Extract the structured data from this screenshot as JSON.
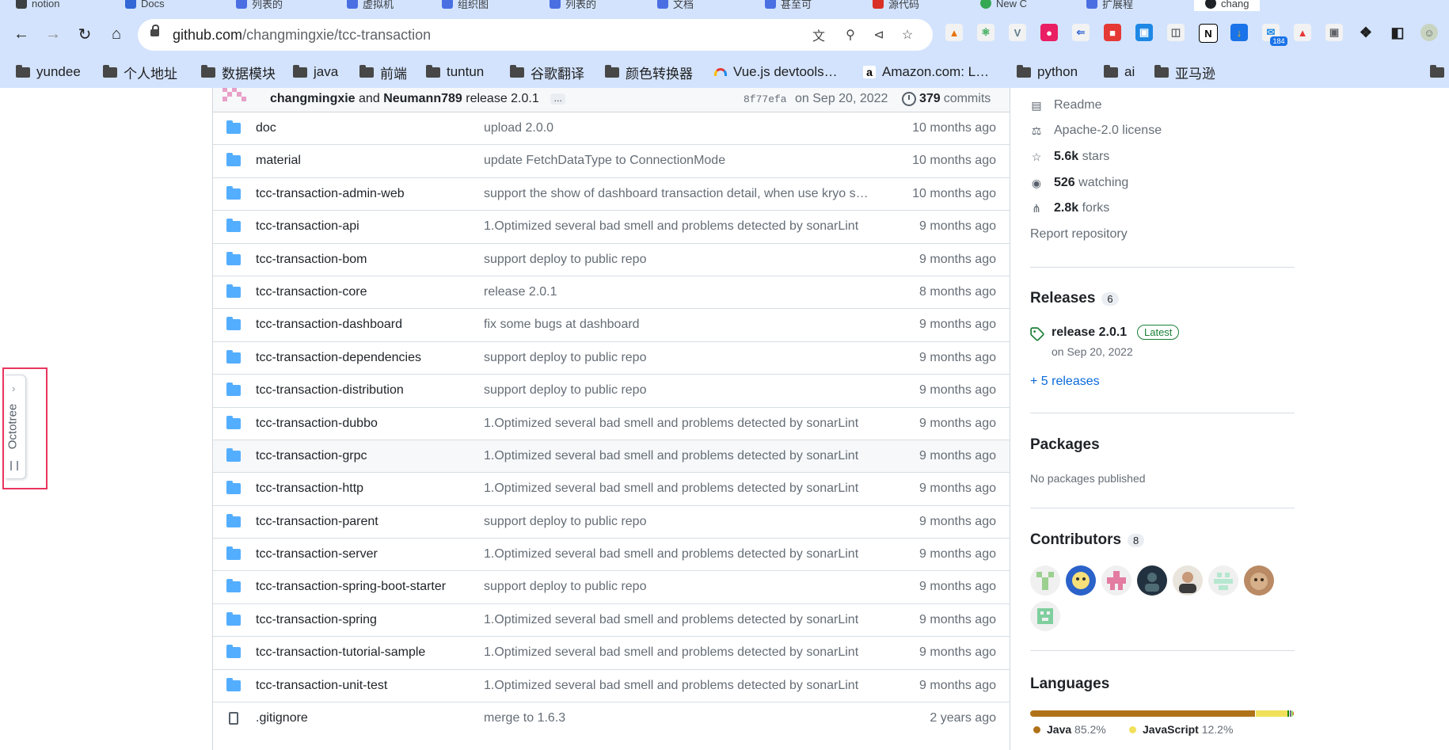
{
  "browser": {
    "tabs": [
      {
        "label": "notion"
      },
      {
        "label": "Docs"
      },
      {
        "label": "列表的"
      },
      {
        "label": "虚拟机"
      },
      {
        "label": "组织图"
      },
      {
        "label": "列表的"
      },
      {
        "label": "文档"
      },
      {
        "label": "甚至可"
      },
      {
        "label": "源代码"
      },
      {
        "label": "New C"
      },
      {
        "label": "扩展程"
      },
      {
        "label": "chang"
      }
    ],
    "url_domain": "github.com",
    "url_path": "/changmingxie/tcc-transaction",
    "extension_badge": "184",
    "bookmarks": [
      {
        "label": "yundee",
        "icon": "folder-icon"
      },
      {
        "label": "个人地址",
        "icon": "folder-icon"
      },
      {
        "label": "数据模块",
        "icon": "folder-icon"
      },
      {
        "label": "java",
        "icon": "folder-icon"
      },
      {
        "label": "前端",
        "icon": "folder-icon"
      },
      {
        "label": "tuntun",
        "icon": "folder-icon"
      },
      {
        "label": "谷歌翻译",
        "icon": "folder-icon"
      },
      {
        "label": "颜色转换器",
        "icon": "folder-icon"
      },
      {
        "label": "Vue.js devtools…",
        "icon": "rainbow-icon"
      },
      {
        "label": "Amazon.com: L…",
        "icon": "amazon-icon"
      },
      {
        "label": "python",
        "icon": "folder-icon"
      },
      {
        "label": "ai",
        "icon": "folder-icon"
      },
      {
        "label": "亚马逊",
        "icon": "folder-icon"
      }
    ]
  },
  "commit": {
    "author1": "changmingxie",
    "and": "and",
    "author2": "Neumann789",
    "message": "release 2.0.1",
    "dots": "…",
    "sha": "8f77efa",
    "date": "on Sep 20, 2022",
    "commit_count": "379",
    "commit_word": "commits"
  },
  "files": [
    {
      "name": "doc",
      "type": "dir",
      "message": "upload 2.0.0",
      "age": "10 months ago"
    },
    {
      "name": "material",
      "type": "dir",
      "message": "update FetchDataType to ConnectionMode",
      "age": "10 months ago"
    },
    {
      "name": "tcc-transaction-admin-web",
      "type": "dir",
      "message": "support the show of dashboard transaction detail, when use kryo s…",
      "age": "10 months ago"
    },
    {
      "name": "tcc-transaction-api",
      "type": "dir",
      "message": "1.Optimized several bad smell and problems detected by sonarLint",
      "age": "9 months ago"
    },
    {
      "name": "tcc-transaction-bom",
      "type": "dir",
      "message": "support deploy to public repo",
      "age": "9 months ago"
    },
    {
      "name": "tcc-transaction-core",
      "type": "dir",
      "message": "release 2.0.1",
      "age": "8 months ago"
    },
    {
      "name": "tcc-transaction-dashboard",
      "type": "dir",
      "message": "fix some bugs at dashboard",
      "age": "9 months ago"
    },
    {
      "name": "tcc-transaction-dependencies",
      "type": "dir",
      "message": "support deploy to public repo",
      "age": "9 months ago"
    },
    {
      "name": "tcc-transaction-distribution",
      "type": "dir",
      "message": "support deploy to public repo",
      "age": "9 months ago"
    },
    {
      "name": "tcc-transaction-dubbo",
      "type": "dir",
      "message": "1.Optimized several bad smell and problems detected by sonarLint",
      "age": "9 months ago"
    },
    {
      "name": "tcc-transaction-grpc",
      "type": "dir",
      "message": "1.Optimized several bad smell and problems detected by sonarLint",
      "age": "9 months ago"
    },
    {
      "name": "tcc-transaction-http",
      "type": "dir",
      "message": "1.Optimized several bad smell and problems detected by sonarLint",
      "age": "9 months ago"
    },
    {
      "name": "tcc-transaction-parent",
      "type": "dir",
      "message": "support deploy to public repo",
      "age": "9 months ago"
    },
    {
      "name": "tcc-transaction-server",
      "type": "dir",
      "message": "1.Optimized several bad smell and problems detected by sonarLint",
      "age": "9 months ago"
    },
    {
      "name": "tcc-transaction-spring-boot-starter",
      "type": "dir",
      "message": "support deploy to public repo",
      "age": "9 months ago"
    },
    {
      "name": "tcc-transaction-spring",
      "type": "dir",
      "message": "1.Optimized several bad smell and problems detected by sonarLint",
      "age": "9 months ago"
    },
    {
      "name": "tcc-transaction-tutorial-sample",
      "type": "dir",
      "message": "1.Optimized several bad smell and problems detected by sonarLint",
      "age": "9 months ago"
    },
    {
      "name": "tcc-transaction-unit-test",
      "type": "dir",
      "message": "1.Optimized several bad smell and problems detected by sonarLint",
      "age": "9 months ago"
    },
    {
      "name": ".gitignore",
      "type": "file",
      "message": "merge to 1.6.3",
      "age": "2 years ago"
    }
  ],
  "sidebar": {
    "readme": "Readme",
    "license": "Apache-2.0 license",
    "stars_count": "5.6k",
    "stars_word": "stars",
    "watching_count": "526",
    "watching_word": "watching",
    "forks_count": "2.8k",
    "forks_word": "forks",
    "report": "Report repository",
    "releases_title": "Releases",
    "releases_count": "6",
    "release_name": "release 2.0.1",
    "release_badge": "Latest",
    "release_date": "on Sep 20, 2022",
    "more_releases": "+ 5 releases",
    "packages_title": "Packages",
    "packages_empty": "No packages published",
    "contributors_title": "Contributors",
    "contributors_count": "8",
    "languages_title": "Languages",
    "languages": [
      {
        "name": "Java",
        "percent": "85.2%",
        "value": 85.2,
        "color": "#b07219"
      },
      {
        "name": "JavaScript",
        "percent": "12.2%",
        "value": 12.2,
        "color": "#f1e05a"
      }
    ]
  },
  "octotree": {
    "label": "Octotree"
  }
}
